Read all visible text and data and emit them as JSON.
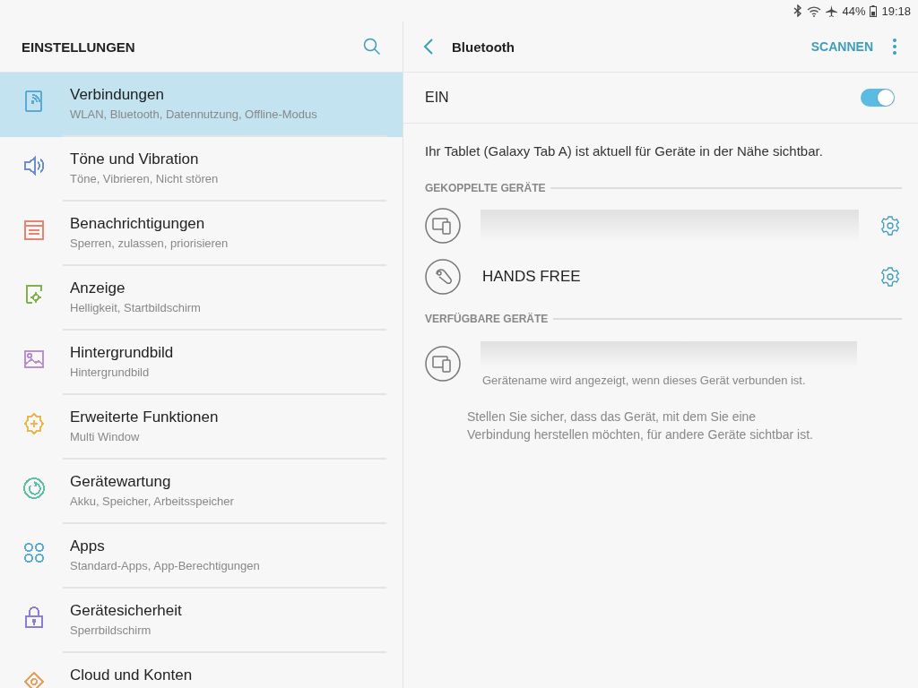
{
  "status_bar": {
    "battery": "44%",
    "time": "19:18"
  },
  "settings": {
    "title": "EINSTELLUNGEN",
    "items": [
      {
        "kind": "connections",
        "color": "#5aa9d6",
        "title": "Verbindungen",
        "subtitle": "WLAN, Bluetooth, Datennutzung, Offline-Modus",
        "selected": true
      },
      {
        "kind": "sound",
        "color": "#6a8fd0",
        "title": "Töne und Vibration",
        "subtitle": "Töne, Vibrieren, Nicht stören",
        "selected": false
      },
      {
        "kind": "notifications",
        "color": "#e8836f",
        "title": "Benachrichtigungen",
        "subtitle": "Sperren, zulassen, priorisieren",
        "selected": false
      },
      {
        "kind": "display",
        "color": "#7fb24a",
        "title": "Anzeige",
        "subtitle": "Helligkeit, Startbildschirm",
        "selected": false
      },
      {
        "kind": "wallpaper",
        "color": "#b98fd0",
        "title": "Hintergrundbild",
        "subtitle": "Hintergrundbild",
        "selected": false
      },
      {
        "kind": "advanced",
        "color": "#e8b84f",
        "title": "Erweiterte Funktionen",
        "subtitle": "Multi Window",
        "selected": false
      },
      {
        "kind": "maintenance",
        "color": "#5fc0a8",
        "title": "Gerätewartung",
        "subtitle": "Akku, Speicher, Arbeitsspeicher",
        "selected": false
      },
      {
        "kind": "apps",
        "color": "#5aa9d6",
        "title": "Apps",
        "subtitle": "Standard-Apps, App-Berechtigungen",
        "selected": false
      },
      {
        "kind": "security",
        "color": "#8b7fd0",
        "title": "Gerätesicherheit",
        "subtitle": "Sperrbildschirm",
        "selected": false
      },
      {
        "kind": "cloud",
        "color": "#e8a05f",
        "title": "Cloud und Konten",
        "selected": false
      }
    ]
  },
  "bluetooth": {
    "title": "Bluetooth",
    "scan": "SCANNEN",
    "switch_label": "EIN",
    "on": true,
    "visibility": "Ihr Tablet (Galaxy Tab A) ist aktuell für Geräte in der Nähe sichtbar.",
    "paired_header": "GEKOPPELTE GERÄTE",
    "paired": [
      {
        "kind": "tablet",
        "redacted": true
      },
      {
        "kind": "headset",
        "name": "HANDS FREE"
      }
    ],
    "available_header": "VERFÜGBARE GERÄTE",
    "available": [
      {
        "kind": "tablet",
        "redacted": true,
        "note": "Gerätename wird angezeigt, wenn dieses Gerät verbunden ist."
      }
    ],
    "hint": "Stellen Sie sicher, dass das Gerät, mit dem Sie eine Verbindung herstellen möchten, für andere Geräte sichtbar ist."
  }
}
